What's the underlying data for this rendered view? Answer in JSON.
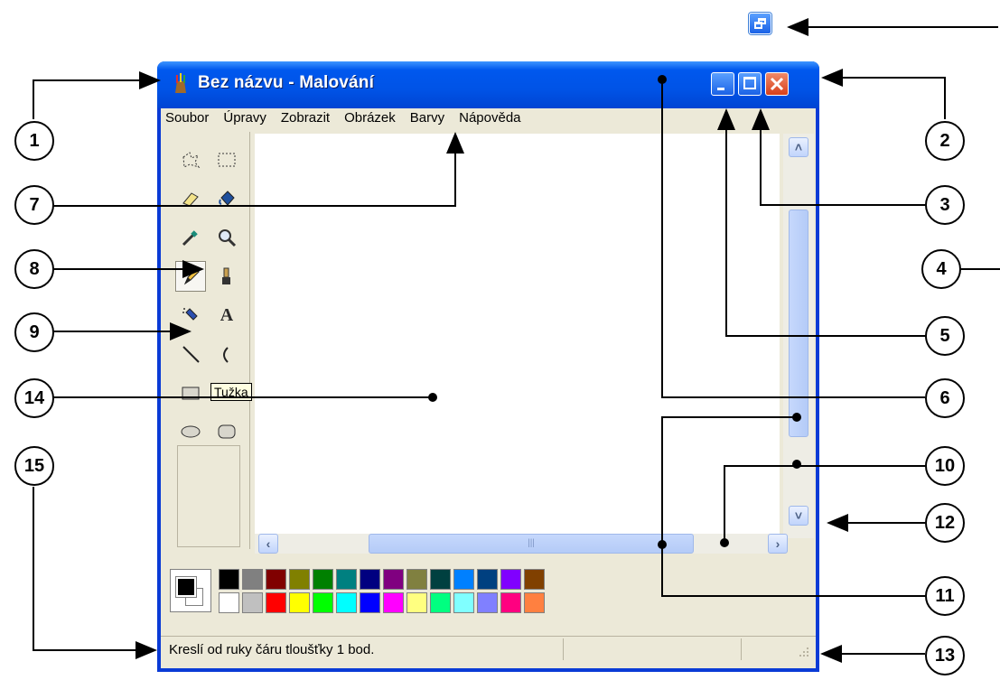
{
  "window": {
    "title": "Bez názvu - Malování",
    "menu": [
      "Soubor",
      "Úpravy",
      "Zobrazit",
      "Obrázek",
      "Barvy",
      "Nápověda"
    ]
  },
  "tooltip": "Tužka",
  "status_text": "Kreslí od ruky čáru tloušťky 1 bod.",
  "palette": {
    "row1": [
      "#000000",
      "#808080",
      "#800000",
      "#808000",
      "#008000",
      "#008080",
      "#000080",
      "#800080",
      "#808040",
      "#004040",
      "#0080ff",
      "#004080",
      "#8000ff",
      "#804000"
    ],
    "row2": [
      "#ffffff",
      "#c0c0c0",
      "#ff0000",
      "#ffff00",
      "#00ff00",
      "#00ffff",
      "#0000ff",
      "#ff00ff",
      "#ffff80",
      "#00ff80",
      "#80ffff",
      "#8080ff",
      "#ff0080",
      "#ff8040"
    ]
  },
  "callouts": [
    "1",
    "2",
    "3",
    "4",
    "5",
    "6",
    "7",
    "8",
    "9",
    "10",
    "11",
    "12",
    "13",
    "14",
    "15"
  ]
}
